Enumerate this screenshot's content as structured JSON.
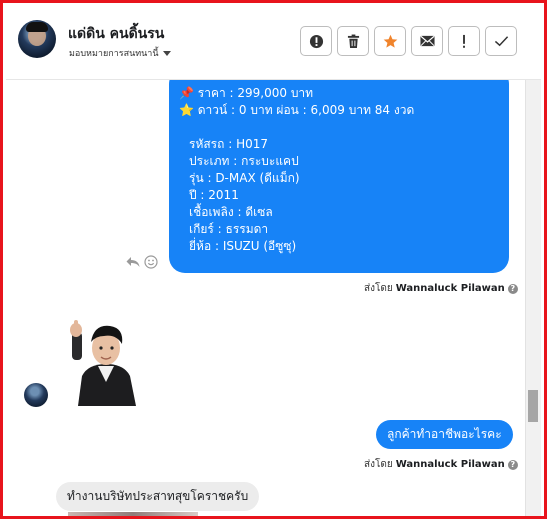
{
  "header": {
    "contact_name": "แด่ดิน คนดิ้นรน",
    "assign_label": "มอบหมายการสนทนานี้"
  },
  "toolbar": {
    "icons": [
      "alert-circle-icon",
      "trash-icon",
      "star-icon",
      "mail-icon",
      "exclamation-icon",
      "check-icon"
    ],
    "colors": {
      "star": "#f0842c",
      "border": "#bdbdbd"
    }
  },
  "messages": {
    "car_listing": {
      "price": "📌 ราคา : 299,000 บาท",
      "down": "⭐ ดาวน์ : 0 บาท ผ่อน : 6,009 บาท 84 งวด",
      "code": "รหัสรถ : H017",
      "type": "ประเภท : กระบะแคป",
      "model": "รุ่น : D-MAX (ดีแม็ก)",
      "year": "ปี : 2011",
      "fuel": "เชื้อเพลิง : ดีเซล",
      "gear": "เกียร์ : ธรรมดา",
      "brand": "ยี่ห้อ : ISUZU (อีซูซุ)"
    },
    "sent_by_prefix": "ส่งโดย",
    "sent_by_name": "Wannaluck Pilawan",
    "reply_out": "ลูกค้าทำอาชีพอะไรคะ",
    "reply_in": "ทำงานบริษัทประสาทสุขโคราชครับ"
  },
  "colors": {
    "accent_blue": "#1783f7",
    "frame_red": "#e8141c",
    "incoming_bubble": "#ececec"
  }
}
